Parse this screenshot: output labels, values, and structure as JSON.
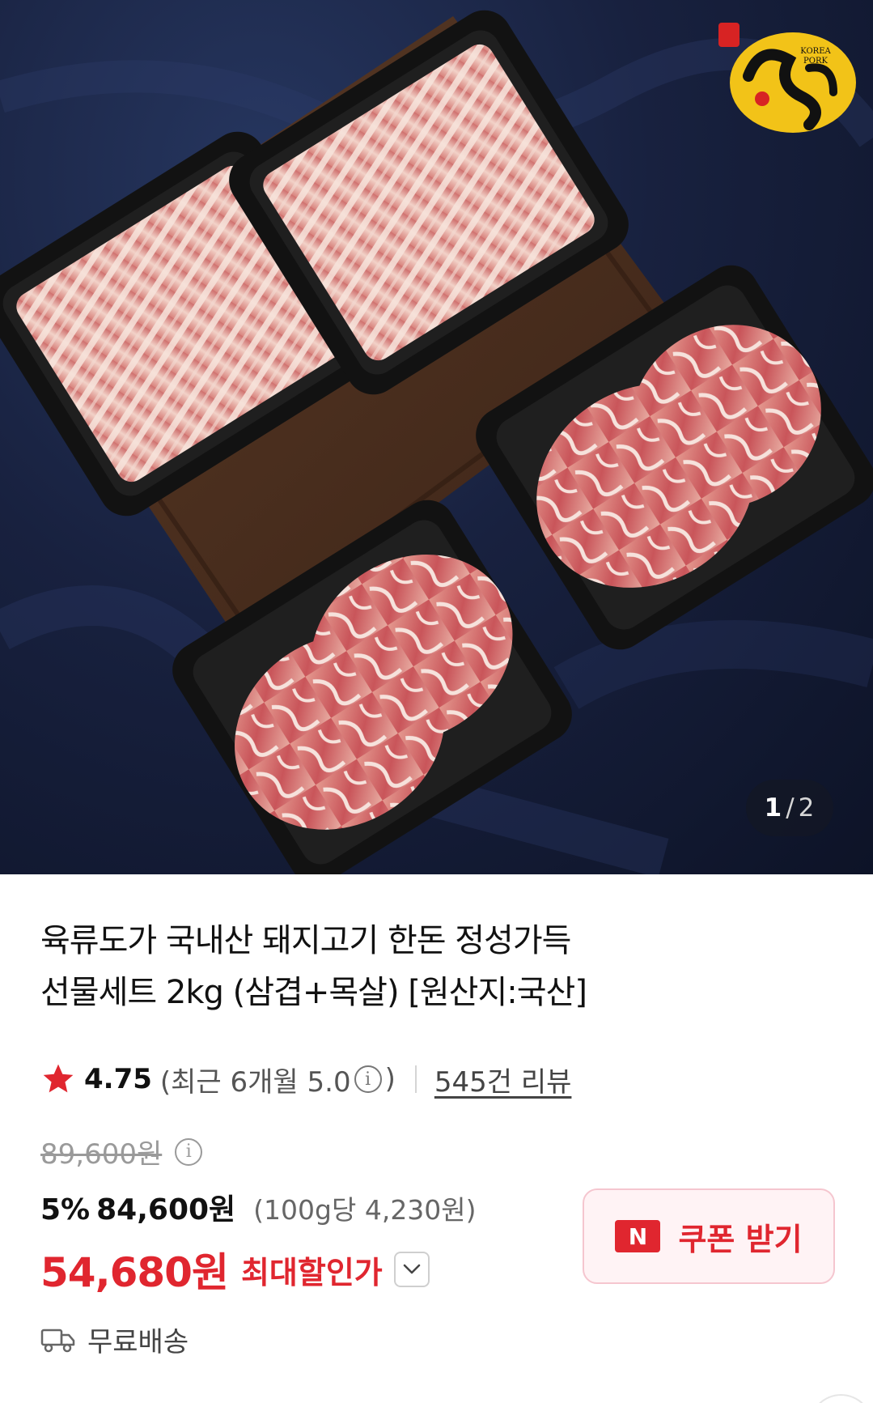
{
  "gallery": {
    "current": "1",
    "separator": "/",
    "total": "2",
    "logo_text": "KOREA PORK"
  },
  "product": {
    "title_line1": "육류도가 국내산 돼지고기 한돈 정성가득",
    "title_line2": "선물세트 2kg (삼겹+목살) [원산지:국산]"
  },
  "rating": {
    "score": "4.75",
    "recent_prefix": "(최근 6개월 5.0",
    "recent_suffix": ")",
    "review_count": "545건 리뷰"
  },
  "price": {
    "original": "89,600원",
    "discount_rate": "5%",
    "sale_price": "84,600원",
    "unit_price": "(100g당 4,230원)",
    "max_discount_price": "54,680원",
    "max_discount_label": "최대할인가"
  },
  "coupon": {
    "badge": "N",
    "label": "쿠폰 받기"
  },
  "shipping": {
    "label": "무료배송"
  },
  "colors": {
    "accent_red": "#e0262f",
    "star": "#e0262f",
    "cloth_navy": "#18213f"
  }
}
